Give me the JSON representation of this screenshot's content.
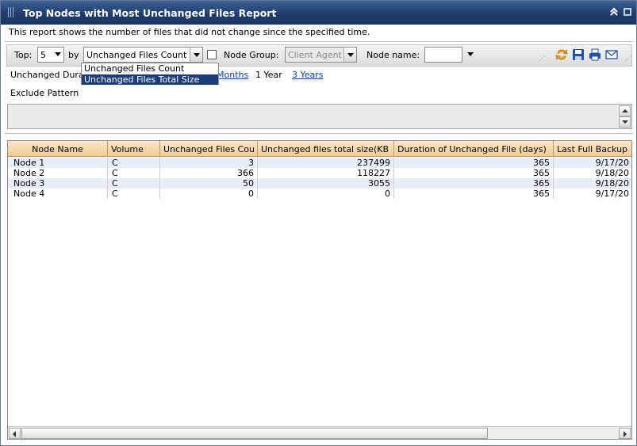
{
  "window": {
    "title": "Top Nodes with Most Unchanged Files Report",
    "collapse_icon": "double-chevron-up-icon",
    "maximize_icon": "maximize-icon"
  },
  "description": "This report shows the number of files that did not change since the specified time.",
  "toolbar": {
    "top_label": "Top:",
    "top_value": "5",
    "by_label": "by",
    "by_value": "Unchanged Files Count",
    "by_options": [
      "Unchanged Files Count",
      "Unchanged Files Total Size"
    ],
    "by_highlighted": "Unchanged Files Total Size",
    "node_group_label": "Node Group:",
    "node_group_value": "Client Agent",
    "node_group_checked": false,
    "node_name_label": "Node name:",
    "node_name_value": "",
    "icons": [
      "refresh-icon",
      "save-icon",
      "print-icon",
      "email-icon"
    ]
  },
  "duration": {
    "label": "Unchanged Dura",
    "options": [
      {
        "label": "Months",
        "link": true
      },
      {
        "label": "1 Year",
        "link": false
      },
      {
        "label": "3 Years",
        "link": true
      }
    ]
  },
  "exclude_pattern": {
    "label": "Exclude Pattern",
    "value": ""
  },
  "table": {
    "columns": [
      "Node Name",
      "Volume",
      "Unchanged Files Cou",
      "Unchanged files total size(KB",
      "Duration of Unchanged File (days)",
      "Last Full Backup"
    ],
    "rows": [
      {
        "node": "Node 1",
        "volume": "C",
        "count": "3",
        "size": "237499",
        "duration": "365",
        "backup": "9/17/20"
      },
      {
        "node": "Node 2",
        "volume": "C",
        "count": "366",
        "size": "118227",
        "duration": "365",
        "backup": "9/18/20"
      },
      {
        "node": "Node 3",
        "volume": "C",
        "count": "50",
        "size": "3055",
        "duration": "365",
        "backup": "9/18/20"
      },
      {
        "node": "Node 4",
        "volume": "C",
        "count": "0",
        "size": "0",
        "duration": "365",
        "backup": "9/17/20"
      }
    ]
  },
  "colors": {
    "titlebar": "#1f3d6d",
    "header": "#f2cc92",
    "selection": "#1d3c7a",
    "link": "#0b3cc2"
  }
}
